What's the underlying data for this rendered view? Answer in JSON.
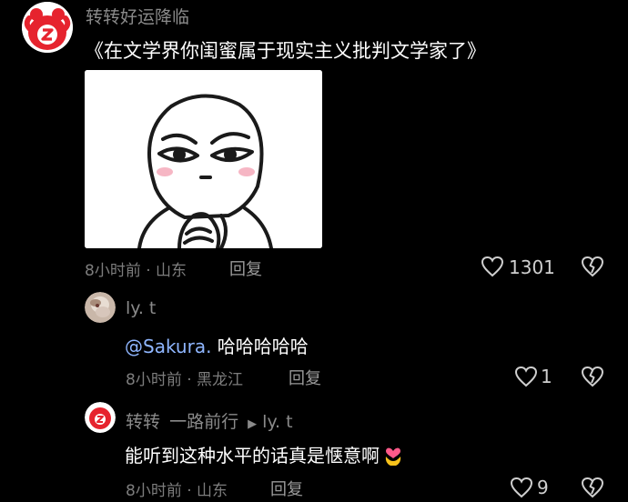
{
  "colors": {
    "background": "#000000",
    "username": "#8a8a8a",
    "text": "#ffffff",
    "meta": "#7d7d7d",
    "mention": "#8fb6ff",
    "avatar_red": "#e6232e"
  },
  "main_comment": {
    "username": "转转好运降临",
    "text": "《在文学界你闺蜜属于现实主义批判文学家了》",
    "time_location": "8小时前 · 山东",
    "reply_label": "回复",
    "like_count": "1301"
  },
  "replies": [
    {
      "username": "ly. t",
      "mention": "@Sakura.",
      "text": " 哈哈哈哈哈",
      "time_location": "8小时前 · 黑龙江",
      "reply_label": "回复",
      "like_count": "1"
    },
    {
      "username": "转转",
      "tag": "一路前行",
      "reply_to": "ly. t",
      "text": "能听到这种水平的话真是惬意啊",
      "time_location": "8小时前 · 山东",
      "reply_label": "回复",
      "like_count": "9"
    }
  ],
  "icons": {
    "like": "heart-outline-icon",
    "dislike": "broken-heart-icon",
    "reply_arrow": "play-arrow-icon",
    "emoji": "gold-heart-hands-emoji"
  }
}
